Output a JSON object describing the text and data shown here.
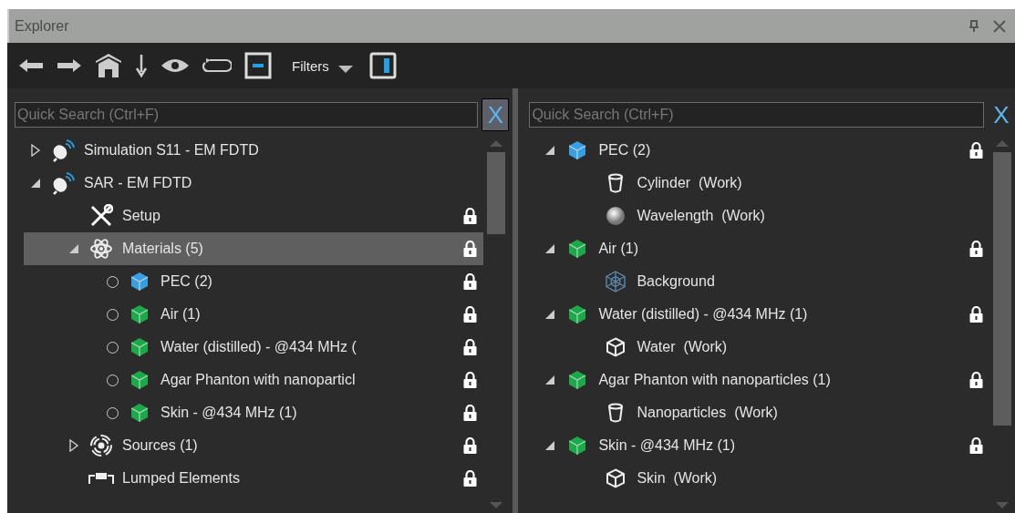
{
  "window": {
    "title": "Explorer"
  },
  "toolbar": {
    "filters_label": "Filters"
  },
  "left_panel": {
    "search": {
      "placeholder": "Quick Search (Ctrl+F)"
    },
    "clear_button": {
      "label": "X",
      "highlighted": true
    },
    "tree": [
      {
        "label": "Simulation S11 - EM FDTD",
        "kind": "antenna",
        "expanded": false,
        "locked": false,
        "selected": false
      },
      {
        "label": "SAR - EM FDTD",
        "kind": "antenna",
        "expanded": true,
        "locked": false,
        "selected": false,
        "children": [
          {
            "label": "Setup",
            "kind": "tools",
            "locked": true,
            "selected": false
          },
          {
            "label": "Materials (5)",
            "kind": "atom",
            "expanded": true,
            "locked": true,
            "selected": true,
            "children": [
              {
                "label": "PEC (2)",
                "kind": "cube",
                "color": "#3a9ee0",
                "active": false,
                "locked": true,
                "selected": false
              },
              {
                "label": "Air (1)",
                "kind": "cube",
                "color": "#1fa84a",
                "active": false,
                "locked": true,
                "selected": false
              },
              {
                "label": "Water (distilled) - @434 MHz (",
                "kind": "cube",
                "color": "#1fa84a",
                "active": false,
                "locked": true,
                "selected": false
              },
              {
                "label": "Agar Phanton with nanoparticl",
                "kind": "cube",
                "color": "#1fa84a",
                "active": false,
                "locked": true,
                "selected": false
              },
              {
                "label": "Skin - @434 MHz (1)",
                "kind": "cube",
                "color": "#1fa84a",
                "active": false,
                "locked": true,
                "selected": false
              }
            ]
          },
          {
            "label": "Sources (1)",
            "kind": "source",
            "expanded": false,
            "locked": true,
            "selected": false
          },
          {
            "label": "Lumped Elements",
            "kind": "lumped",
            "locked": true,
            "selected": false
          }
        ]
      }
    ]
  },
  "right_panel": {
    "search": {
      "placeholder": "Quick Search (Ctrl+F)"
    },
    "clear_button": {
      "label": "X",
      "highlighted": false
    },
    "tree": [
      {
        "label": "PEC (2)",
        "kind": "cube",
        "color": "#3a9ee0",
        "expanded": true,
        "locked": true,
        "selected": false,
        "children": [
          {
            "label": "Cylinder  (Work)",
            "kind": "cylinder",
            "locked": false,
            "selected": false
          },
          {
            "label": "Wavelength  (Work)",
            "kind": "sphere",
            "locked": false,
            "selected": false
          }
        ]
      },
      {
        "label": "Air (1)",
        "kind": "cube",
        "color": "#1fa84a",
        "expanded": true,
        "locked": true,
        "selected": false,
        "children": [
          {
            "label": "Background",
            "kind": "wireframe",
            "locked": false,
            "selected": false
          }
        ]
      },
      {
        "label": "Water (distilled) - @434 MHz (1)",
        "kind": "cube",
        "color": "#1fa84a",
        "expanded": true,
        "locked": true,
        "selected": false,
        "children": [
          {
            "label": "Water  (Work)",
            "kind": "box",
            "locked": false,
            "selected": false
          }
        ]
      },
      {
        "label": "Agar Phanton with nanoparticles (1)",
        "kind": "cube",
        "color": "#1fa84a",
        "expanded": true,
        "locked": true,
        "selected": false,
        "children": [
          {
            "label": "Nanoparticles  (Work)",
            "kind": "cylinder",
            "locked": false,
            "selected": false
          }
        ]
      },
      {
        "label": "Skin - @434 MHz (1)",
        "kind": "cube",
        "color": "#1fa84a",
        "expanded": true,
        "locked": true,
        "selected": false,
        "children": [
          {
            "label": "Skin  (Work)",
            "kind": "box",
            "locked": false,
            "selected": false
          }
        ]
      }
    ]
  }
}
